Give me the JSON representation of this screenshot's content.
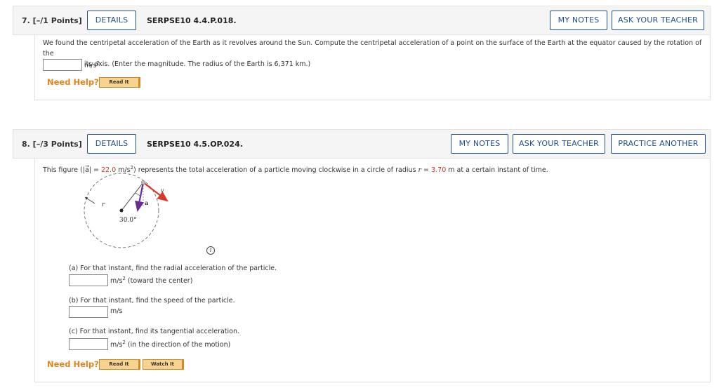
{
  "q7": {
    "number": "7.  [–/1 Points]",
    "details": "DETAILS",
    "code": "SERPSE10 4.4.P.018.",
    "my_notes": "MY NOTES",
    "ask_teacher": "ASK YOUR TEACHER",
    "text_line1": "We found the centripetal acceleration of the Earth as it revolves around the Sun. Compute the centripetal acceleration of a point on the surface of the Earth at the equator caused by the rotation of the",
    "text_line2": "Earth about its axis. (Enter the magnitude. The radius of the Earth is 6,371 km.)",
    "answer_value": "",
    "unit": "m/s",
    "unit_exp": "2",
    "need_help": "Need Help?",
    "read_it": "Read It"
  },
  "q8": {
    "number": "8.  [–/3 Points]",
    "details": "DETAILS",
    "code": "SERPSE10 4.5.OP.024.",
    "my_notes": "MY NOTES",
    "ask_teacher": "ASK YOUR TEACHER",
    "practice": "PRACTICE ANOTHER",
    "intro_a": "This figure (|",
    "intro_vec": "a",
    "intro_b": "| = ",
    "accel_value": "22.0",
    "intro_c": " m/s",
    "intro_exp": "2",
    "intro_d": ") represents the total acceleration of a particle moving clockwise in a circle of radius ",
    "intro_r": "r",
    "intro_e": " = ",
    "radius_value": "3.70",
    "intro_f": " m at a certain instant of time.",
    "figure": {
      "label_r": "r",
      "label_a": "a",
      "label_v": "v",
      "angle": "30.0°"
    },
    "part_a": {
      "prompt": "(a) For that instant, find the radial acceleration of the particle.",
      "value": "",
      "unit": "m/s",
      "unit_exp": "2",
      "unit_note": " (toward the center)"
    },
    "part_b": {
      "prompt": "(b) For that instant, find the speed of the particle.",
      "value": "",
      "unit": "m/s"
    },
    "part_c": {
      "prompt": "(c) For that instant, find its tangential acceleration.",
      "value": "",
      "unit": "m/s",
      "unit_exp": "2",
      "unit_note": " (in the direction of the motion)"
    },
    "need_help": "Need Help?",
    "read_it": "Read It",
    "watch_it": "Watch It"
  },
  "colors": {
    "button_text": "#1f4e8c",
    "need_help": "#e3841a",
    "value_red": "#c0392b",
    "accel_arrow": "#6a2c91",
    "velocity_arrow": "#d63a2a"
  }
}
